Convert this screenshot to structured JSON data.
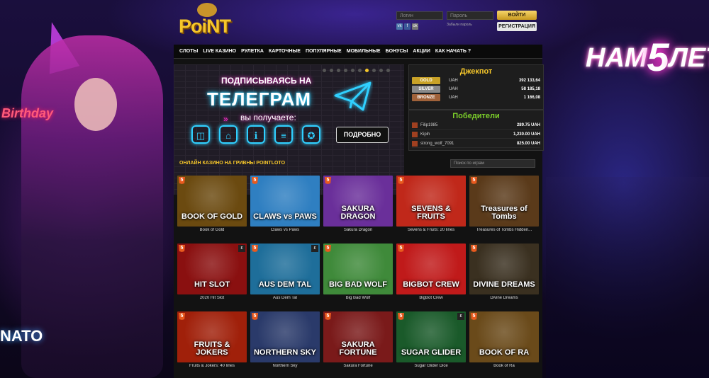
{
  "brand": {
    "logo_text": "PoiNT",
    "anniversary_pre": "НАМ",
    "anniversary_num": "5",
    "anniversary_post": "ЛЕТ"
  },
  "background": {
    "sign_text": "Birthday",
    "bottom_text": "NATO"
  },
  "auth": {
    "login_placeholder": "Логин",
    "password_placeholder": "Пароль",
    "login_button": "ВОЙТИ",
    "register_button": "РЕГИСТРАЦИЯ",
    "forgot_text": "Забыли пароль"
  },
  "socials": [
    {
      "label": "vk",
      "color": "#4a76a8"
    },
    {
      "label": "f",
      "color": "#3b5998"
    },
    {
      "label": "ok",
      "color": "#777777"
    }
  ],
  "nav": [
    "СЛОТЫ",
    "LIVE КАЗИНО",
    "РУЛЕТКА",
    "КАРТОЧНЫЕ",
    "ПОПУЛЯРНЫЕ",
    "МОБИЛЬНЫЕ",
    "БОНУСЫ",
    "АКЦИИ",
    "КАК НАЧАТЬ ?"
  ],
  "banner": {
    "line1": "ПОДПИСЫВАЯСЬ НА",
    "line2": "ТЕЛЕГРАМ",
    "line3": "вы получаете:",
    "button": "ПОДРОБНО",
    "slides_count": 10,
    "active_slide": 6,
    "icons": [
      "gamepad-icon",
      "gift-icon",
      "info-icon",
      "document-icon",
      "badge-icon"
    ]
  },
  "jackpot": {
    "title": "Джекпот",
    "rows": [
      {
        "tier": "GOLD",
        "color": "#c9a227",
        "currency": "UAH",
        "value": "392 133,64"
      },
      {
        "tier": "SILVER",
        "color": "#8a8a8a",
        "currency": "UAH",
        "value": "58 185,18"
      },
      {
        "tier": "BRONZE",
        "color": "#a0623a",
        "currency": "UAH",
        "value": "1 166,08"
      }
    ]
  },
  "winners": {
    "title": "Победители",
    "rows": [
      {
        "name": "Filip1985",
        "amount": "289.75 UAH"
      },
      {
        "name": "Kipih",
        "amount": "1,230.00 UAH"
      },
      {
        "name": "strong_wolf_7091",
        "amount": "825.00 UAH"
      }
    ]
  },
  "section": {
    "title": "ОНЛАЙН КАЗИНО НА ГРИВНЫ POINTLOTO",
    "search_placeholder": "Поиск по играм"
  },
  "games": [
    {
      "name": "Book of Gold",
      "art": "BOOK OF GOLD",
      "bg": "#6b4a10",
      "prov": false
    },
    {
      "name": "Claws vs Paws",
      "art": "CLAWS vs PAWS",
      "bg": "#2f7fc1",
      "prov": false
    },
    {
      "name": "Sakura Dragon",
      "art": "SAKURA DRAGON",
      "bg": "#6a2f9a",
      "prov": false
    },
    {
      "name": "Sevens & Fruits: 20 lines",
      "art": "SEVENS & FRUITS",
      "bg": "#c0281a",
      "prov": false
    },
    {
      "name": "Treasures of Tombs Hidden...",
      "art": "Treasures of Tombs",
      "bg": "#5a3a1a",
      "prov": false
    },
    {
      "name": "2020 Hit Slot",
      "art": "HIT SLOT",
      "bg": "#8a1010",
      "prov": true
    },
    {
      "name": "Aus Dem Tal",
      "art": "AUS DEM TAL",
      "bg": "#1e6e9a",
      "prov": true
    },
    {
      "name": "Big Bad Wolf",
      "art": "BIG BAD WOLF",
      "bg": "#3f8a3a",
      "prov": false
    },
    {
      "name": "BigBot Crew",
      "art": "BIGBOT CREW",
      "bg": "#c01a1a",
      "prov": false
    },
    {
      "name": "Divine Dreams",
      "art": "DIVINE DREAMS",
      "bg": "#3a3020",
      "prov": false
    },
    {
      "name": "Fruits & Jokers: 40 lines",
      "art": "FRUITS & JOKERS",
      "bg": "#a0200a",
      "prov": false
    },
    {
      "name": "Northern Sky",
      "art": "NORTHERN SKY",
      "bg": "#2a3a6a",
      "prov": false
    },
    {
      "name": "Sakura Fortune",
      "art": "SAKURA FORTUNE",
      "bg": "#7a1a1a",
      "prov": false
    },
    {
      "name": "Sugar Glider Dice",
      "art": "SUGAR GLIDER",
      "bg": "#1a5a2a",
      "prov": true
    },
    {
      "name": "Book of Ra",
      "art": "BOOK OF RA",
      "bg": "#6a4a1a",
      "prov": false
    }
  ]
}
